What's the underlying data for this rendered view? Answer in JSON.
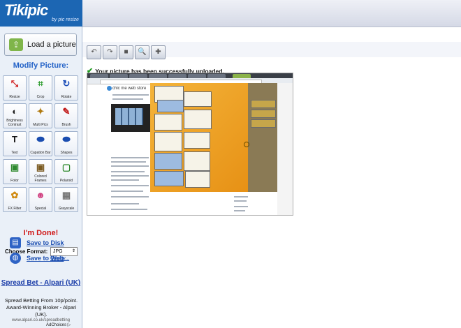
{
  "header": {
    "logo_text": "Tikipic",
    "logo_sub": "by pic resize"
  },
  "sidebar": {
    "load_button_label": "Load a picture",
    "modify_title": "Modify Picture:",
    "tools": [
      {
        "label": "Resize",
        "icon": "resize-icon",
        "glyph": "⤡",
        "color": "#d02020"
      },
      {
        "label": "Crop",
        "icon": "crop-icon",
        "glyph": "⌗",
        "color": "#2a9a2a"
      },
      {
        "label": "Rotate",
        "icon": "rotate-icon",
        "glyph": "↻",
        "color": "#1b4db8"
      },
      {
        "label": "Brightness Contrast",
        "icon": "brightness-icon",
        "glyph": "◐",
        "color": "#222222"
      },
      {
        "label": "Multi Pics",
        "icon": "multi-pics-icon",
        "glyph": "✦",
        "color": "#b07a10"
      },
      {
        "label": "Brush",
        "icon": "brush-icon",
        "glyph": "✎",
        "color": "#c01818"
      },
      {
        "label": "Text",
        "icon": "text-icon",
        "glyph": "T",
        "color": "#111111"
      },
      {
        "label": "Capation Bar",
        "icon": "caption-bar-icon",
        "glyph": "⬬",
        "color": "#1a4db0"
      },
      {
        "label": "Shapes",
        "icon": "shapes-icon",
        "glyph": "⬬",
        "color": "#1a4db0"
      },
      {
        "label": "Fotor",
        "icon": "fotor-icon",
        "glyph": "▣",
        "color": "#2f8a2f"
      },
      {
        "label": "Colored Frames",
        "icon": "colored-frames-icon",
        "glyph": "▣",
        "color": "#7a5a20"
      },
      {
        "label": "Polaroid",
        "icon": "polaroid-icon",
        "glyph": "▢",
        "color": "#2f8a2f"
      },
      {
        "label": "FX Filter",
        "icon": "fx-filter-icon",
        "glyph": "✿",
        "color": "#d08a10"
      },
      {
        "label": "Special",
        "icon": "special-icon",
        "glyph": "☻",
        "color": "#d04080"
      },
      {
        "label": "Grayscale",
        "icon": "grayscale-icon",
        "glyph": "▦",
        "color": "#777777"
      }
    ],
    "done_label": "I'm Done!",
    "format_label": "Choose Format:",
    "format_value": "JPG",
    "quality_link": "Quality...",
    "save_disk_label": "Save to Disk",
    "save_web_label": "Save to Web",
    "ad": {
      "title": "Spread Bet - Alpari (UK)",
      "body": "Spread Betting From 10p/point. Award-Winning Broker - Alpari (UK).",
      "url": "www.alpari.co.uk/spreadbetting",
      "choices": "AdChoices ▷"
    }
  },
  "toolbar": {
    "buttons": [
      {
        "name": "undo-button",
        "glyph": "↶"
      },
      {
        "name": "redo-button",
        "glyph": "↷"
      },
      {
        "name": "compare-button",
        "glyph": "■"
      },
      {
        "name": "zoom-button",
        "glyph": "🔍"
      },
      {
        "name": "color-picker-button",
        "glyph": "✚"
      }
    ]
  },
  "status": {
    "message": "Your picture has been successfully uploaded."
  },
  "preview": {
    "site_name": "chic me web store"
  }
}
